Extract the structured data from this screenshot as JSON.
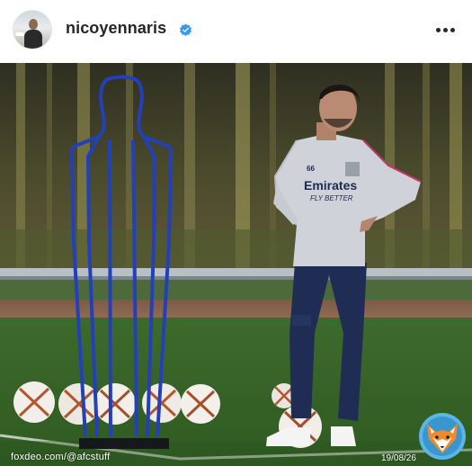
{
  "header": {
    "username": "nicoyennaris",
    "verified": true,
    "avatar_icon": "profile-avatar",
    "more_icon": "more-horizontal-icon",
    "verified_icon": "verified-badge-icon",
    "accent_color": "#3897f0"
  },
  "photo": {
    "kit_sponsor": "Emirates",
    "kit_tagline": "FLY BETTER",
    "squad_number": "66"
  },
  "overlay": {
    "watermark": "foxdeo.com/@afcstuff",
    "date": "19/08/26",
    "logo_icon": "fox-logo-icon"
  }
}
